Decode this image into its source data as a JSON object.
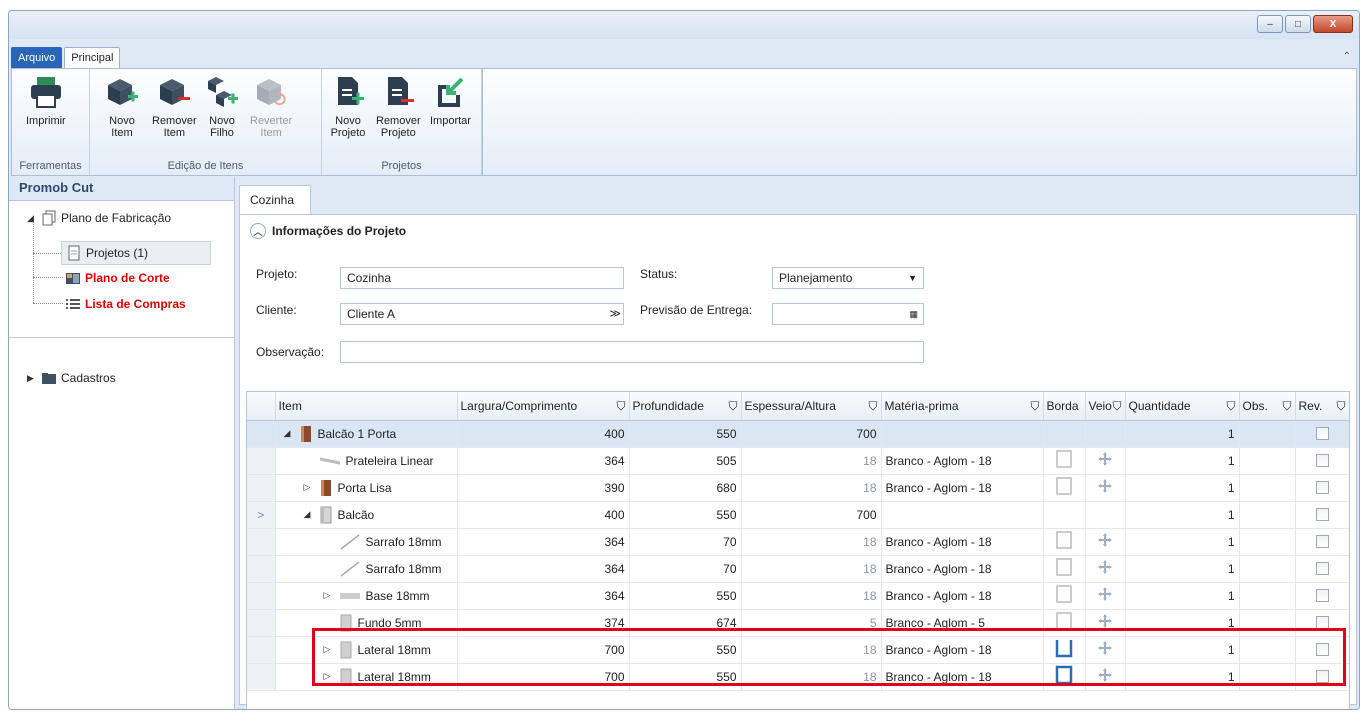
{
  "window": {
    "minimize": "–",
    "maximize": "□",
    "close": "X"
  },
  "ribbon_tabs": [
    "Arquivo",
    "Principal"
  ],
  "ribbon": {
    "groups": [
      {
        "label": "Ferramentas",
        "buttons": [
          {
            "label1": "Imprimir",
            "label2": "",
            "icon": "printer-icon",
            "enabled": true
          }
        ]
      },
      {
        "label": "Edição de Itens",
        "buttons": [
          {
            "label1": "Novo",
            "label2": "Item",
            "icon": "add-item-icon",
            "enabled": true
          },
          {
            "label1": "Remover",
            "label2": "Item",
            "icon": "remove-item-icon",
            "enabled": true
          },
          {
            "label1": "Novo",
            "label2": "Filho",
            "icon": "add-child-icon",
            "enabled": true
          },
          {
            "label1": "Reverter",
            "label2": "Item",
            "icon": "revert-item-icon",
            "enabled": false
          }
        ]
      },
      {
        "label": "Projetos",
        "buttons": [
          {
            "label1": "Novo",
            "label2": "Projeto",
            "icon": "new-project-icon",
            "enabled": true
          },
          {
            "label1": "Remover",
            "label2": "Projeto",
            "icon": "remove-project-icon",
            "enabled": true
          },
          {
            "label1": "Importar",
            "label2": "",
            "icon": "import-icon",
            "enabled": true
          }
        ]
      }
    ]
  },
  "left_panel": {
    "title": "Promob Cut",
    "tree": {
      "root": "Plano de Fabricação",
      "children": [
        "Projetos (1)",
        "Plano de Corte",
        "Lista de Compras"
      ],
      "cadastros": "Cadastros"
    }
  },
  "doc_tab": "Cozinha",
  "form": {
    "section_title": "Informações do Projeto",
    "projeto_label": "Projeto:",
    "projeto_value": "Cozinha",
    "cliente_label": "Cliente:",
    "cliente_value": "Cliente A",
    "status_label": "Status:",
    "status_value": "Planejamento",
    "previsao_label": "Previsão de Entrega:",
    "previsao_value": "",
    "observacao_label": "Observação:",
    "observacao_value": ""
  },
  "grid": {
    "columns": [
      "Item",
      "Largura/Comprimento",
      "Profundidade",
      "Espessura/Altura",
      "Matéria-prima",
      "Borda",
      "Veio",
      "Quantidade",
      "Obs.",
      "Rev."
    ],
    "rows": [
      {
        "level": 0,
        "expander": "◢",
        "icon": "door",
        "name": "Balcão 1 Porta",
        "largura": "400",
        "prof": "550",
        "esp": "700",
        "materia": "",
        "borda": false,
        "veio": false,
        "qtd": "1",
        "sel": true,
        "ptr": ""
      },
      {
        "level": 1,
        "expander": "",
        "icon": "shelf",
        "name": "Prateleira Linear",
        "largura": "364",
        "prof": "505",
        "esp": "18",
        "materia": "Branco - Aglom - 18",
        "borda": "box",
        "veio": true,
        "qtd": "1",
        "sel": false,
        "ptr": ""
      },
      {
        "level": 1,
        "expander": "▷",
        "icon": "door",
        "name": "Porta Lisa",
        "largura": "390",
        "prof": "680",
        "esp": "18",
        "materia": "Branco - Aglom - 18",
        "borda": "box",
        "veio": true,
        "qtd": "1",
        "sel": false,
        "ptr": ""
      },
      {
        "level": 1,
        "expander": "◢",
        "icon": "cabinet",
        "name": "Balcão",
        "largura": "400",
        "prof": "550",
        "esp": "700",
        "materia": "",
        "borda": false,
        "veio": false,
        "qtd": "1",
        "sel": false,
        "ptr": ">"
      },
      {
        "level": 2,
        "expander": "",
        "icon": "strip",
        "name": "Sarrafo 18mm",
        "largura": "364",
        "prof": "70",
        "esp": "18",
        "materia": "Branco - Aglom - 18",
        "borda": "box",
        "veio": true,
        "qtd": "1",
        "sel": false,
        "ptr": ""
      },
      {
        "level": 2,
        "expander": "",
        "icon": "strip",
        "name": "Sarrafo 18mm",
        "largura": "364",
        "prof": "70",
        "esp": "18",
        "materia": "Branco - Aglom - 18",
        "borda": "box",
        "veio": true,
        "qtd": "1",
        "sel": false,
        "ptr": ""
      },
      {
        "level": 2,
        "expander": "▷",
        "icon": "base",
        "name": "Base 18mm",
        "largura": "364",
        "prof": "550",
        "esp": "18",
        "materia": "Branco - Aglom - 18",
        "borda": "box",
        "veio": true,
        "qtd": "1",
        "sel": false,
        "ptr": ""
      },
      {
        "level": 2,
        "expander": "",
        "icon": "panel",
        "name": "Fundo 5mm",
        "largura": "374",
        "prof": "674",
        "esp": "5",
        "materia": "Branco - Aglom - 5",
        "borda": "box",
        "veio": true,
        "qtd": "1",
        "sel": false,
        "ptr": ""
      },
      {
        "level": 2,
        "expander": "▷",
        "icon": "panel",
        "name": "Lateral 18mm",
        "largura": "700",
        "prof": "550",
        "esp": "18",
        "materia": "Branco - Aglom - 18",
        "borda": "blue3",
        "veio": true,
        "qtd": "1",
        "sel": false,
        "ptr": ""
      },
      {
        "level": 2,
        "expander": "▷",
        "icon": "panel",
        "name": "Lateral 18mm",
        "largura": "700",
        "prof": "550",
        "esp": "18",
        "materia": "Branco - Aglom - 18",
        "borda": "blue4",
        "veio": true,
        "qtd": "1",
        "sel": false,
        "ptr": ""
      }
    ]
  }
}
